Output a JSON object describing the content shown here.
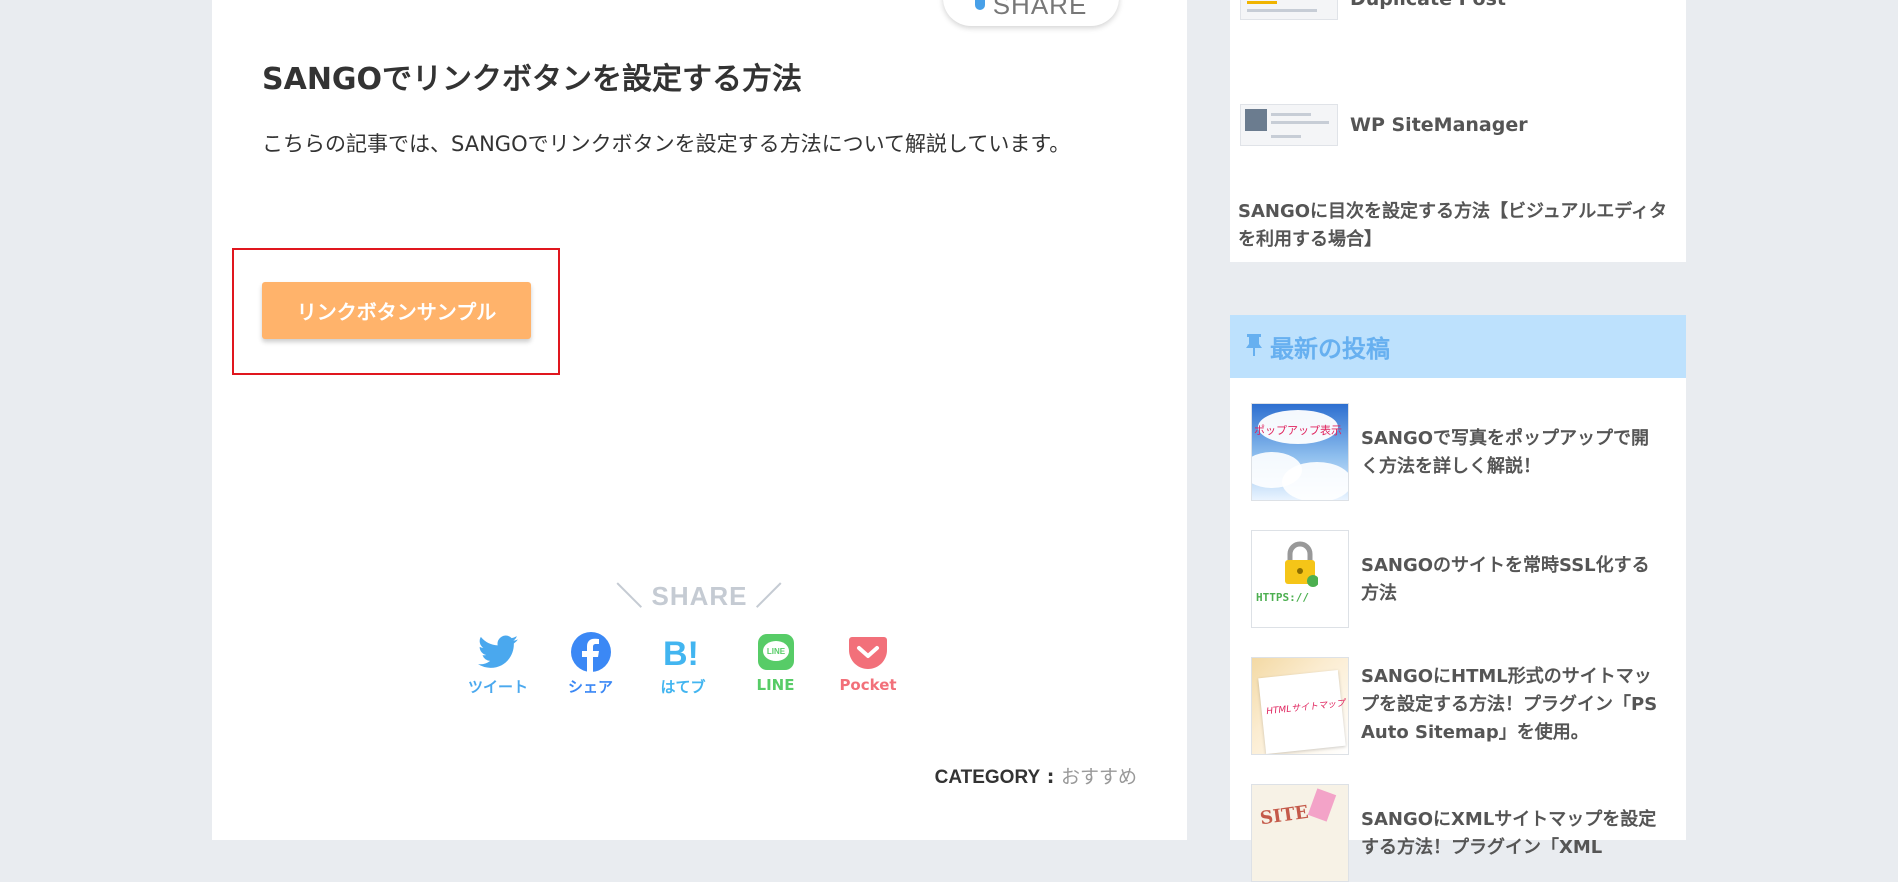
{
  "article": {
    "top_share_label": "SHARE",
    "title": "SANGOでリンクボタンを設定する方法",
    "description": "こちらの記事では、SANGOでリンクボタンを設定する方法について解説しています。",
    "link_button_label": "リンクボタンサンプル",
    "share_heading": "＼ SHARE ／",
    "share_buttons": [
      {
        "label": "ツイート",
        "icon": "twitter-icon",
        "color": "#4aa8ee"
      },
      {
        "label": "シェア",
        "icon": "facebook-icon",
        "color": "#3b88f5"
      },
      {
        "label": "はてブ",
        "icon": "hatena-bookmark-icon",
        "color": "#42b5f0"
      },
      {
        "label": "LINE",
        "icon": "line-icon",
        "color": "#57cc67"
      },
      {
        "label": "Pocket",
        "icon": "pocket-icon",
        "color": "#f2707a"
      }
    ],
    "category_label": "CATEGORY",
    "category_sep": " : ",
    "category_value": "おすすめ"
  },
  "sidebar": {
    "popular_items": [
      {
        "title": "Duplicate Post"
      },
      {
        "title": "WP SiteManager"
      }
    ],
    "article_link": "SANGOに目次を設定する方法【ビジュアルエディタを利用する場合】",
    "latest_heading": "最新の投稿",
    "latest_posts": [
      {
        "title": "SANGOで写真をポップアップで開く方法を詳しく解説！",
        "thumb_text": "ポップアップ表示"
      },
      {
        "title": "SANGOのサイトを常時SSL化する方法",
        "thumb_text": "HTTPS://"
      },
      {
        "title": "SANGOにHTML形式のサイトマップを設定する方法！プラグイン「PS Auto Sitemap」を使用。",
        "thumb_text": "HTMLサイトマップ"
      },
      {
        "title": "SANGOにXMLサイトマップを設定する方法！プラグイン「XML",
        "thumb_text": "SITE"
      }
    ]
  },
  "colors": {
    "background": "#e9ecf0",
    "button": "#ffb36b",
    "highlight": "#e0161e",
    "latest_header_bg": "#bde1fd",
    "latest_header_text": "#67b0f0"
  }
}
